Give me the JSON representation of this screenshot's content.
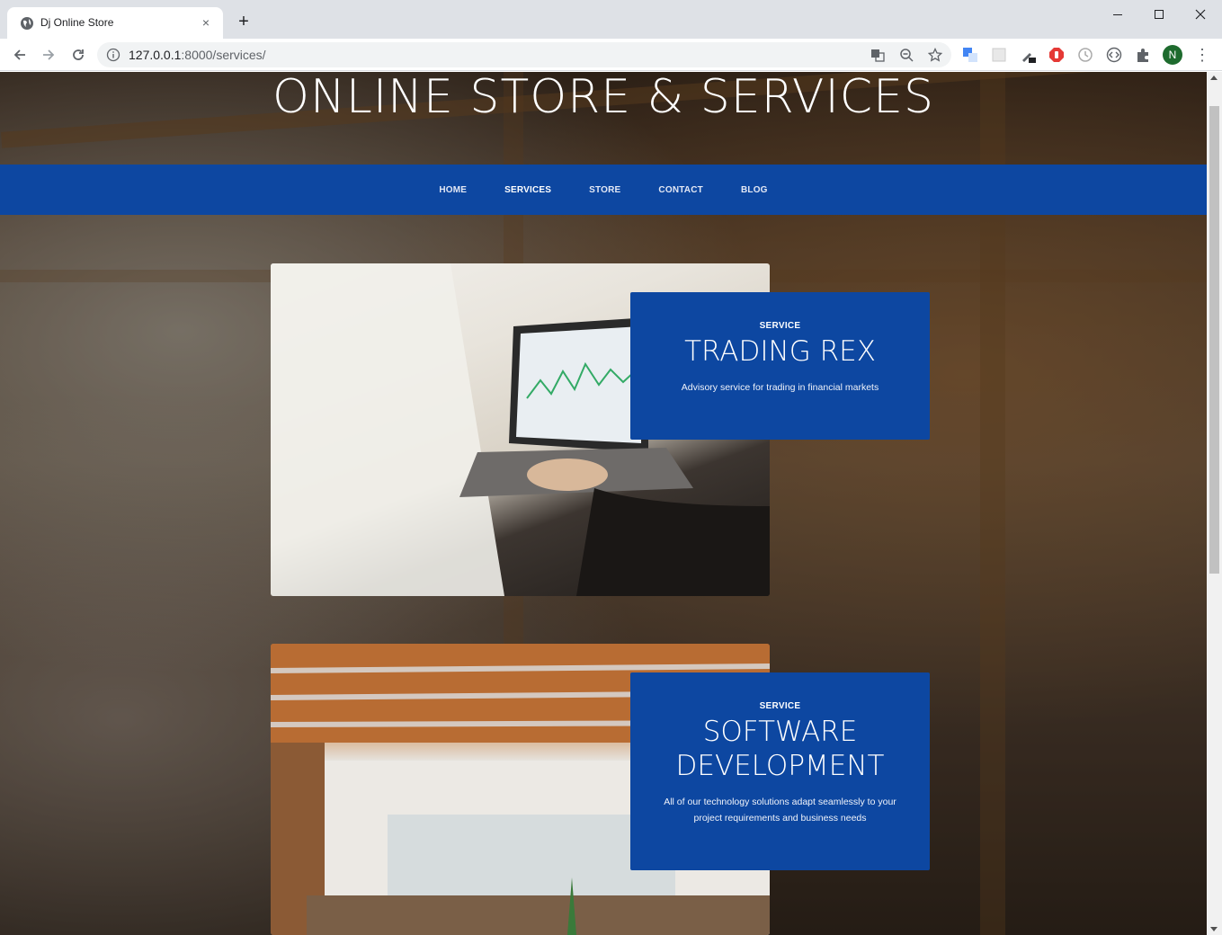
{
  "browser": {
    "tab_title": "Dj Online Store",
    "tab_close": "×",
    "new_tab": "+",
    "url_host": "127.0.0.1",
    "url_rest": ":8000/services/",
    "profile_initial": "N",
    "menu": "⋮",
    "icons": [
      "translate-icon",
      "zoom-out-icon",
      "bookmark-star-icon",
      "extension-translate-icon",
      "extension-blank-icon",
      "extension-eyedropper-icon",
      "extension-adblock-icon",
      "extension-clock-icon",
      "extension-code-icon",
      "extensions-puzzle-icon"
    ]
  },
  "site": {
    "title": "ONLINE STORE & SERVICES",
    "nav": [
      {
        "label": "HOME",
        "active": false
      },
      {
        "label": "SERVICES",
        "active": true
      },
      {
        "label": "STORE",
        "active": false
      },
      {
        "label": "CONTACT",
        "active": false
      },
      {
        "label": "BLOG",
        "active": false
      }
    ],
    "nav_bg": "#0d47a1"
  },
  "services": [
    {
      "kicker": "SERVICE",
      "title": "TRADING REX",
      "description": "Advisory service for trading in financial markets"
    },
    {
      "kicker": "SERVICE",
      "title": "SOFTWARE DEVELOPMENT",
      "description": "All of our technology solutions adapt seamlessly to your project requirements and business needs"
    }
  ]
}
